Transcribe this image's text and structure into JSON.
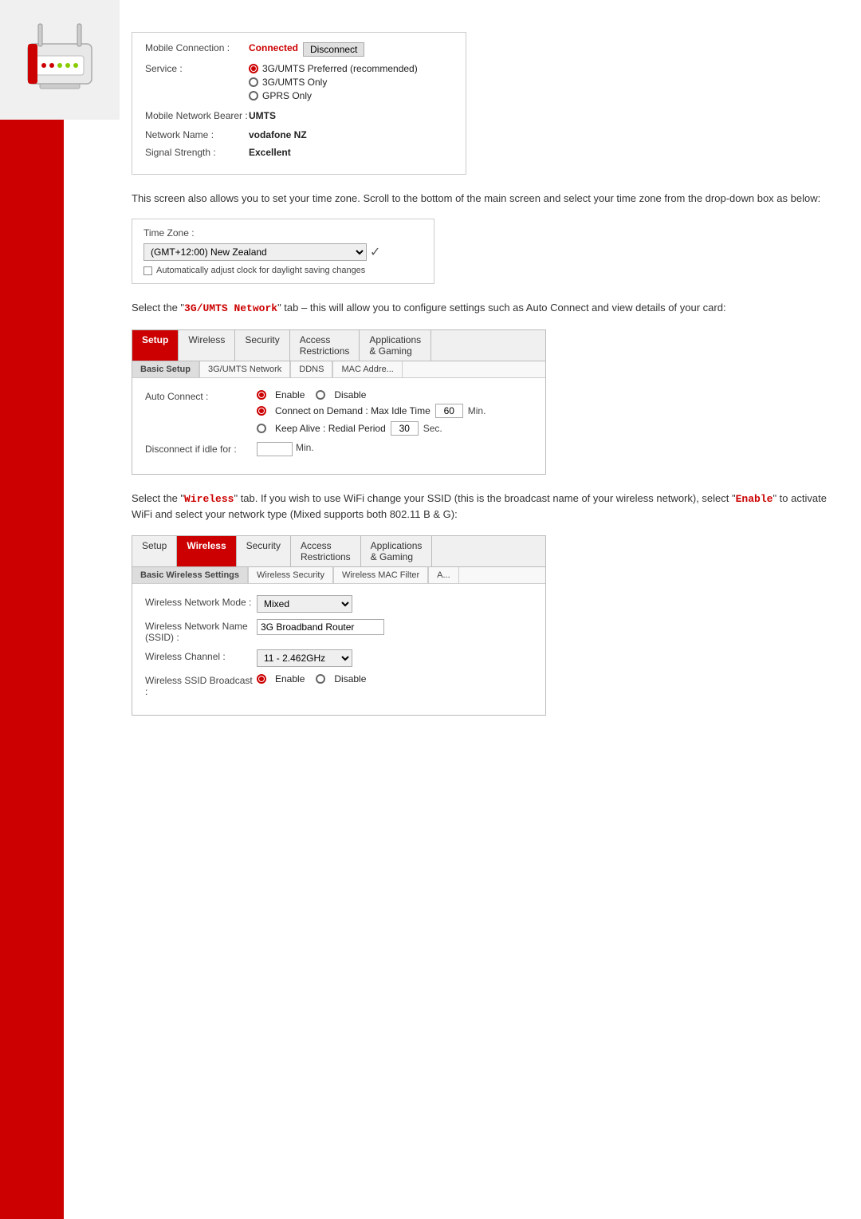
{
  "sidebar": {
    "color": "#cc0000"
  },
  "connection": {
    "mobile_connection_label": "Mobile Connection :",
    "status": "Connected",
    "disconnect_button": "Disconnect",
    "service_label": "Service :",
    "service_options": [
      {
        "label": "3G/UMTS Preferred (recommended)",
        "selected": true
      },
      {
        "label": "3G/UMTS Only",
        "selected": false
      },
      {
        "label": "GPRS Only",
        "selected": false
      }
    ],
    "mobile_network_bearer_label": "Mobile Network Bearer :",
    "mobile_network_bearer_value": "UMTS",
    "network_name_label": "Network Name :",
    "network_name_value": "vodafone NZ",
    "signal_strength_label": "Signal Strength :",
    "signal_strength_value": "Excellent"
  },
  "timezone": {
    "desc": "This screen also allows you to set your time zone. Scroll to the bottom of the main screen and select your time zone from the drop-down box as below:",
    "time_zone_label": "Time Zone :",
    "time_zone_value": "(GMT+12:00) New Zealand",
    "checkbox_label": "Automatically adjust clock for daylight saving changes"
  },
  "umts_section": {
    "desc_before": "Select the \"",
    "highlight": "3G/UMTS Network",
    "desc_after": "\" tab – this will allow you to configure settings such as Auto Connect and view details of your card:",
    "tabs": [
      {
        "label": "Setup",
        "active": true
      },
      {
        "label": "Wireless",
        "active": false
      },
      {
        "label": "Security",
        "active": false
      },
      {
        "label": "Access Restrictions",
        "active": false
      },
      {
        "label": "Applications & Gaming",
        "active": false
      }
    ],
    "sub_tabs": [
      {
        "label": "Basic Setup",
        "active": true
      },
      {
        "label": "3G/UMTS Network",
        "active": false
      },
      {
        "label": "DDNS",
        "active": false
      },
      {
        "label": "MAC Addre...",
        "active": false
      }
    ],
    "auto_connect_label": "Auto Connect :",
    "enable_label": "Enable",
    "disable_label": "Disable",
    "connect_on_demand_label": "Connect on Demand : Max Idle Time",
    "connect_on_demand_value": "60",
    "connect_on_demand_unit": "Min.",
    "keep_alive_label": "Keep Alive : Redial Period",
    "keep_alive_value": "30",
    "keep_alive_unit": "Sec.",
    "disconnect_idle_label": "Disconnect if idle for :",
    "disconnect_idle_placeholder": "Min."
  },
  "wireless_section": {
    "desc_before": "Select the \"",
    "highlight_wireless": "Wireless",
    "desc_middle": "\" tab. If you wish to use WiFi change your SSID (this is the broadcast name of your wireless network), select \"",
    "highlight_enable": "Enable",
    "desc_after": "\" to activate WiFi and select your network type (Mixed supports both 802.11 B & G):",
    "tabs": [
      {
        "label": "Setup",
        "active": false
      },
      {
        "label": "Wireless",
        "active": true
      },
      {
        "label": "Security",
        "active": false
      },
      {
        "label": "Access Restrictions",
        "active": false
      },
      {
        "label": "Applications & Gaming",
        "active": false
      }
    ],
    "sub_tabs": [
      {
        "label": "Basic Wireless Settings",
        "active": true
      },
      {
        "label": "Wireless Security",
        "active": false
      },
      {
        "label": "Wireless MAC Filter",
        "active": false
      },
      {
        "label": "A...",
        "active": false
      }
    ],
    "network_mode_label": "Wireless Network Mode :",
    "network_mode_value": "Mixed",
    "network_name_label": "Wireless Network Name (SSID) :",
    "network_name_value": "3G Broadband Router",
    "channel_label": "Wireless Channel :",
    "channel_value": "11 - 2.462GHz",
    "ssid_broadcast_label": "Wireless SSID Broadcast :",
    "ssid_enable_label": "Enable",
    "ssid_disable_label": "Disable"
  }
}
